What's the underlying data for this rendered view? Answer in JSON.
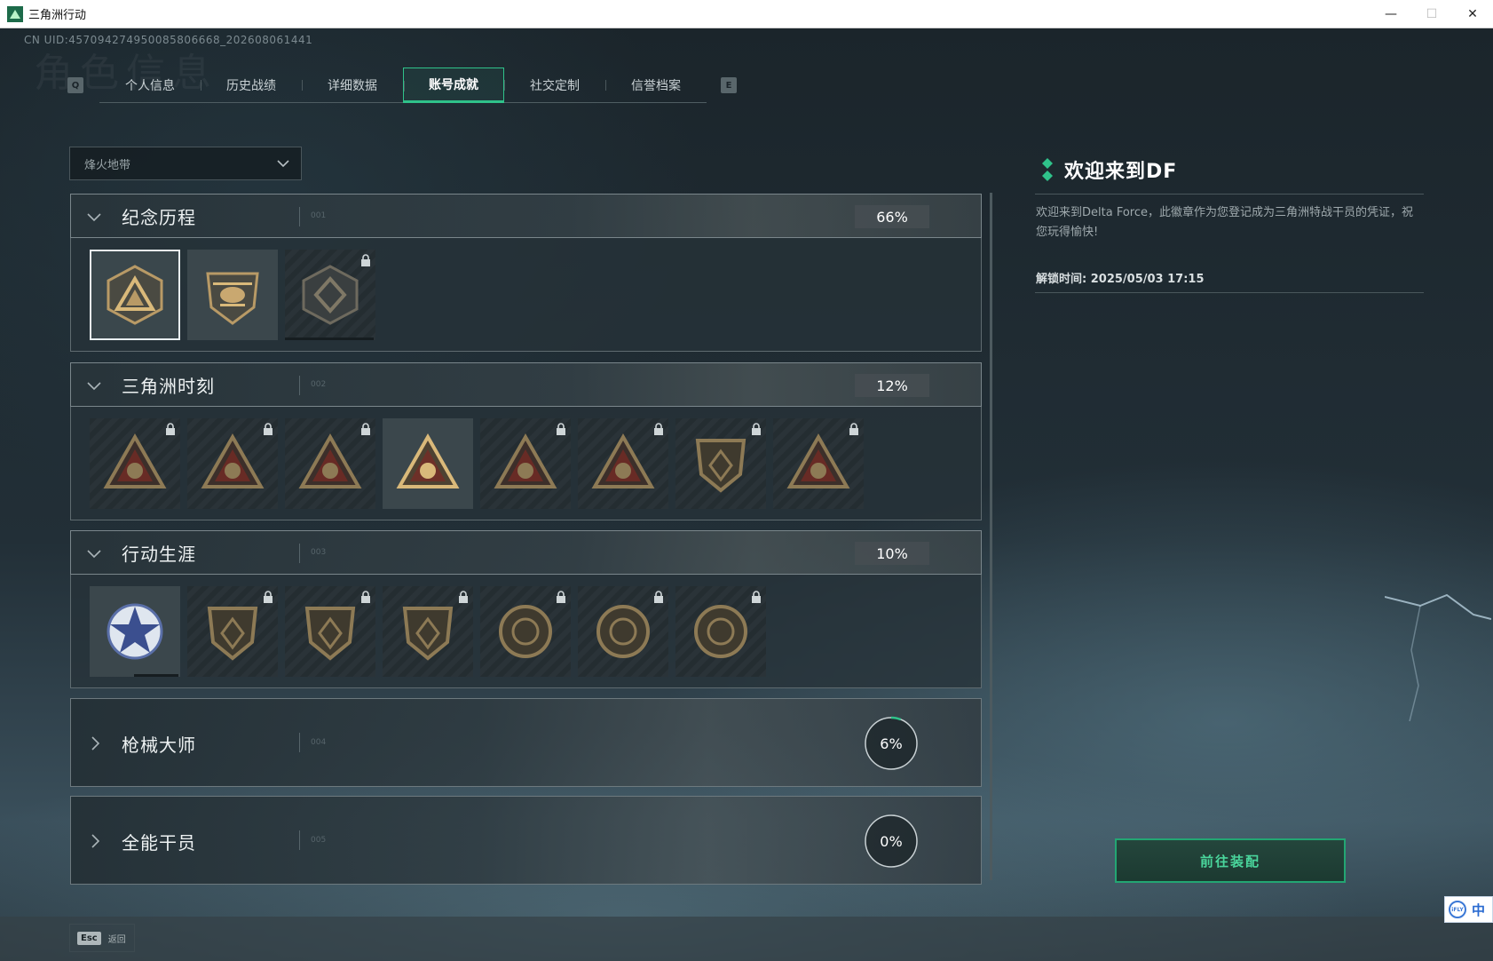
{
  "window": {
    "title": "三角洲行动",
    "minimize": "—",
    "maximize": "☐",
    "close": "✕"
  },
  "uid": "CN UID:457094274950085806668_202608061441",
  "bg_heading": "角色信息",
  "tabs": {
    "prev_key": "Q",
    "next_key": "E",
    "items": [
      {
        "label": "个人信息"
      },
      {
        "label": "历史战绩"
      },
      {
        "label": "详细数据"
      },
      {
        "label": "账号成就",
        "active": true
      },
      {
        "label": "社交定制"
      },
      {
        "label": "信誉档案"
      }
    ]
  },
  "mode_select": {
    "value": "烽火地带"
  },
  "categories": [
    {
      "title": "纪念历程",
      "code": "001",
      "progress": "66%",
      "expanded": true
    },
    {
      "title": "三角洲时刻",
      "code": "002",
      "progress": "12%",
      "expanded": true
    },
    {
      "title": "行动生涯",
      "code": "003",
      "progress": "10%",
      "expanded": true
    },
    {
      "title": "枪械大师",
      "code": "004",
      "progress": "6%",
      "progress_fraction": 0.06,
      "expanded": false
    },
    {
      "title": "全能干员",
      "code": "005",
      "progress": "0%",
      "progress_fraction": 0.0,
      "expanded": false
    }
  ],
  "badge_rows": {
    "memorial": [
      {
        "icon": "delta-triangle-emblem",
        "locked": false,
        "selected": true
      },
      {
        "icon": "helicopter-emblem",
        "locked": false
      },
      {
        "icon": "diamond-shield-emblem",
        "locked": true
      }
    ],
    "moments": [
      {
        "icon": "robot-triangle-emblem",
        "locked": true
      },
      {
        "icon": "soldier-triangle-emblem",
        "locked": true
      },
      {
        "icon": "globe-triangle-emblem",
        "locked": true
      },
      {
        "icon": "squad-triangle-emblem",
        "locked": false
      },
      {
        "icon": "wolf-triangle-emblem",
        "locked": true
      },
      {
        "icon": "dragon-triangle-emblem",
        "locked": true
      },
      {
        "icon": "cube-shield-emblem",
        "locked": true
      },
      {
        "icon": "skull-triangle-emblem",
        "locked": true
      }
    ],
    "career": [
      {
        "icon": "star-wreath-emblem",
        "locked": false
      },
      {
        "icon": "wing-shield-emblem",
        "locked": true
      },
      {
        "icon": "arrow-shield-emblem",
        "locked": true
      },
      {
        "icon": "hex-shield-emblem",
        "locked": true
      },
      {
        "icon": "orb-coin-emblem",
        "locked": true
      },
      {
        "icon": "skull-coin-emblem",
        "locked": true
      },
      {
        "icon": "eye-coin-emblem",
        "locked": true
      }
    ]
  },
  "detail": {
    "title": "欢迎来到DF",
    "description": "欢迎来到Delta Force，此徽章作为您登记成为三角洲特战干员的凭证，祝您玩得愉快!",
    "unlock_time": "解锁时间: 2025/05/03 17:15",
    "equip_button": "前往装配"
  },
  "footer": {
    "esc_key": "Esc",
    "back_label": "返回"
  },
  "ime": {
    "logo": "iFLY",
    "mode": "中"
  },
  "colors": {
    "accent": "#2fc28a",
    "panel": "#263238"
  }
}
